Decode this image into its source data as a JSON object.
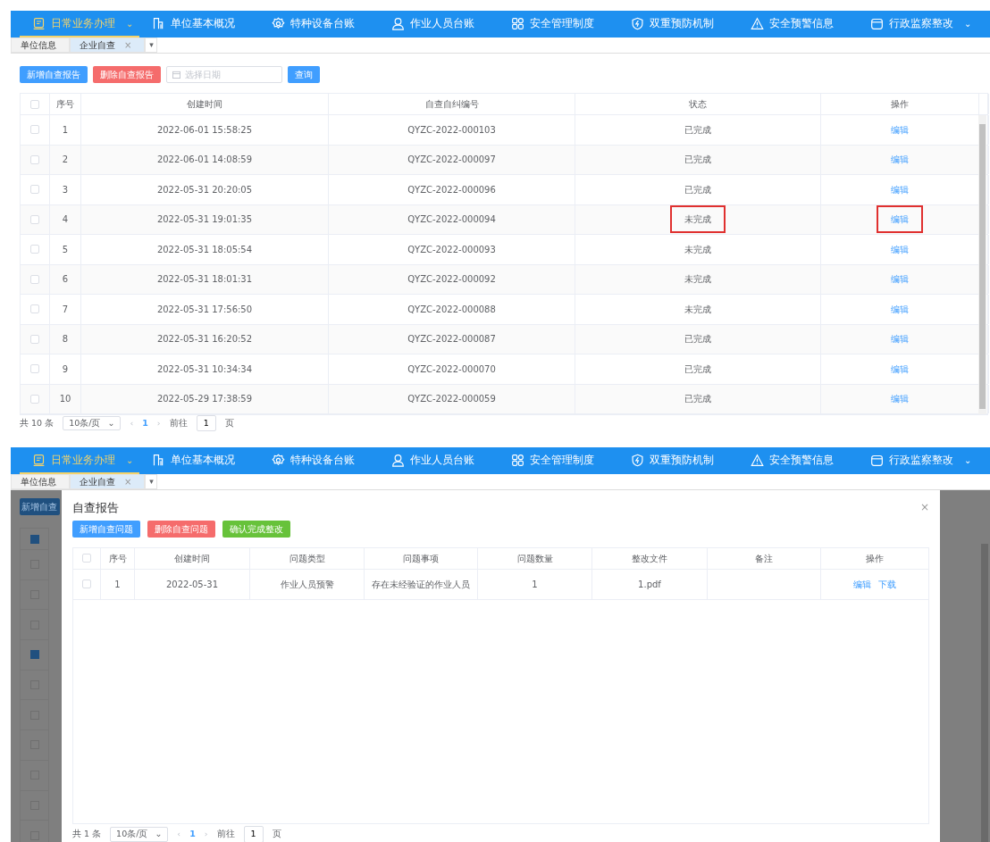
{
  "top_screen": {
    "nav": [
      {
        "label": "日常业务办理",
        "selected": true,
        "caret": "⌄"
      },
      {
        "label": "单位基本概况",
        "selected": false
      },
      {
        "label": "特种设备台账",
        "selected": false
      },
      {
        "label": "作业人员台账",
        "selected": false
      },
      {
        "label": "安全管理制度",
        "selected": false
      },
      {
        "label": "双重预防机制",
        "selected": false
      },
      {
        "label": "安全预警信息",
        "selected": false
      },
      {
        "label": "行政监察整改",
        "selected": false,
        "caret": "⌄"
      }
    ],
    "tabs": [
      {
        "label": "单位信息",
        "selected": false
      },
      {
        "label": "企业自查",
        "selected": true,
        "close": "×"
      }
    ],
    "tab_menu": "▾",
    "toolbar": {
      "add_button": "新增自查报告",
      "delete_button": "删除自查报告",
      "date_field": {
        "placeholder": "选择日期"
      },
      "search_button": "查询"
    },
    "table": {
      "all_checked": false,
      "columns": [
        "序号",
        "创建时间",
        "自查自纠编号",
        "状态",
        "操作"
      ],
      "rows": [
        {
          "index": "1",
          "created": "2022-06-01 15:58:25",
          "code": "QYZC-2022-000103",
          "status": "已完成",
          "action": "编辑",
          "checked": false,
          "highlighted": false
        },
        {
          "index": "2",
          "created": "2022-06-01 14:08:59",
          "code": "QYZC-2022-000097",
          "status": "已完成",
          "action": "编辑",
          "checked": false,
          "highlighted": false
        },
        {
          "index": "3",
          "created": "2022-05-31 20:20:05",
          "code": "QYZC-2022-000096",
          "status": "已完成",
          "action": "编辑",
          "checked": false,
          "highlighted": false
        },
        {
          "index": "4",
          "created": "2022-05-31 19:01:35",
          "code": "QYZC-2022-000094",
          "status": "未完成",
          "action": "编辑",
          "checked": false,
          "highlighted": true
        },
        {
          "index": "5",
          "created": "2022-05-31 18:05:54",
          "code": "QYZC-2022-000093",
          "status": "未完成",
          "action": "编辑",
          "checked": false,
          "highlighted": false
        },
        {
          "index": "6",
          "created": "2022-05-31 18:01:31",
          "code": "QYZC-2022-000092",
          "status": "未完成",
          "action": "编辑",
          "checked": false,
          "highlighted": false
        },
        {
          "index": "7",
          "created": "2022-05-31 17:56:50",
          "code": "QYZC-2022-000088",
          "status": "未完成",
          "action": "编辑",
          "checked": false,
          "highlighted": false
        },
        {
          "index": "8",
          "created": "2022-05-31 16:20:52",
          "code": "QYZC-2022-000087",
          "status": "已完成",
          "action": "编辑",
          "checked": false,
          "highlighted": false
        },
        {
          "index": "9",
          "created": "2022-05-31 10:34:34",
          "code": "QYZC-2022-000070",
          "status": "已完成",
          "action": "编辑",
          "checked": false,
          "highlighted": false
        },
        {
          "index": "10",
          "created": "2022-05-29 17:38:59",
          "code": "QYZC-2022-000059",
          "status": "已完成",
          "action": "编辑",
          "checked": false,
          "highlighted": false
        }
      ]
    },
    "pagination": {
      "total": "共 10 条",
      "page_size": "10条/页",
      "page_size_caret": "⌄",
      "prev": "‹",
      "page": "1",
      "next": "›",
      "goto_label": "前往",
      "goto_value": "1",
      "goto_suffix": "页"
    }
  },
  "bottom_screen": {
    "nav": [
      {
        "label": "日常业务办理",
        "selected": true,
        "caret": "⌄"
      },
      {
        "label": "单位基本概况",
        "selected": false
      },
      {
        "label": "特种设备台账",
        "selected": false
      },
      {
        "label": "作业人员台账",
        "selected": false
      },
      {
        "label": "安全管理制度",
        "selected": false
      },
      {
        "label": "双重预防机制",
        "selected": false
      },
      {
        "label": "安全预警信息",
        "selected": false
      },
      {
        "label": "行政监察整改",
        "selected": false,
        "caret": "⌄"
      }
    ],
    "tabs": [
      {
        "label": "单位信息",
        "selected": false
      },
      {
        "label": "企业自查",
        "selected": true,
        "close": "×"
      }
    ],
    "tab_menu": "▾",
    "background": {
      "add_button": "新增自查",
      "header_partially_checked": true,
      "rows": [
        {
          "checked": false
        },
        {
          "checked": false
        },
        {
          "checked": false
        },
        {
          "checked": true
        },
        {
          "checked": false
        },
        {
          "checked": false
        },
        {
          "checked": false
        },
        {
          "checked": false
        },
        {
          "checked": false
        },
        {
          "checked": false
        }
      ]
    },
    "dialog": {
      "title": "自查报告",
      "close": "×",
      "buttons": [
        {
          "label": "新增自查问题",
          "kind": "primary"
        },
        {
          "label": "删除自查问题",
          "kind": "danger"
        },
        {
          "label": "确认完成整改",
          "kind": "success"
        }
      ],
      "table": {
        "all_checked": false,
        "columns": [
          "序号",
          "创建时间",
          "问题类型",
          "问题事项",
          "问题数量",
          "整改文件",
          "备注",
          "操作"
        ],
        "rows": [
          {
            "index": "1",
            "created": "2022-05-31",
            "type": "作业人员预警",
            "item": "存在未经验证的作业人员",
            "count": "1",
            "file": "1.pdf",
            "note": "",
            "actions": [
              "编辑",
              "下载"
            ],
            "checked": false
          }
        ]
      },
      "pagination": {
        "total": "共 1 条",
        "page_size": "10条/页",
        "page_size_caret": "⌄",
        "prev": "‹",
        "page": "1",
        "next": "›",
        "goto_label": "前往",
        "goto_value": "1",
        "goto_suffix": "页"
      }
    }
  }
}
